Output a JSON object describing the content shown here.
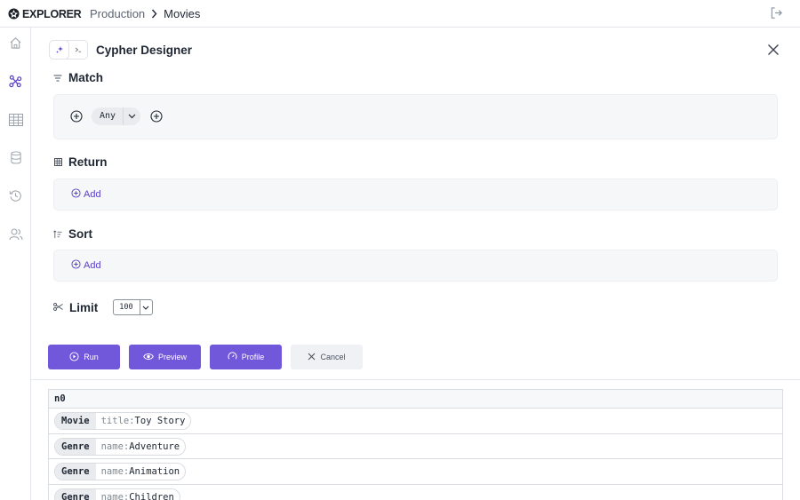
{
  "app": {
    "logo_text": "EXPLORER",
    "breadcrumb": [
      "Production",
      "Movies"
    ]
  },
  "sidebar": {
    "items": [
      {
        "icon": "home-icon"
      },
      {
        "icon": "graph-icon",
        "active": true
      },
      {
        "icon": "table-icon"
      },
      {
        "icon": "database-icon"
      },
      {
        "icon": "history-icon"
      },
      {
        "icon": "users-icon"
      }
    ]
  },
  "designer": {
    "title": "Cypher Designer",
    "match": {
      "label": "Match",
      "node_type": "Any"
    },
    "return": {
      "label": "Return",
      "add_label": "Add"
    },
    "sort": {
      "label": "Sort",
      "add_label": "Add"
    },
    "limit": {
      "label": "Limit",
      "value": "100"
    },
    "buttons": {
      "run": "Run",
      "preview": "Preview",
      "profile": "Profile",
      "cancel": "Cancel"
    }
  },
  "results": {
    "column": "n0",
    "rows": [
      {
        "label": "Movie",
        "key": "title",
        "value": "Toy Story"
      },
      {
        "label": "Genre",
        "key": "name",
        "value": "Adventure"
      },
      {
        "label": "Genre",
        "key": "name",
        "value": "Animation"
      },
      {
        "label": "Genre",
        "key": "name",
        "value": "Children"
      }
    ]
  },
  "colors": {
    "accent": "#7157d9",
    "link": "#5a3fc7"
  }
}
